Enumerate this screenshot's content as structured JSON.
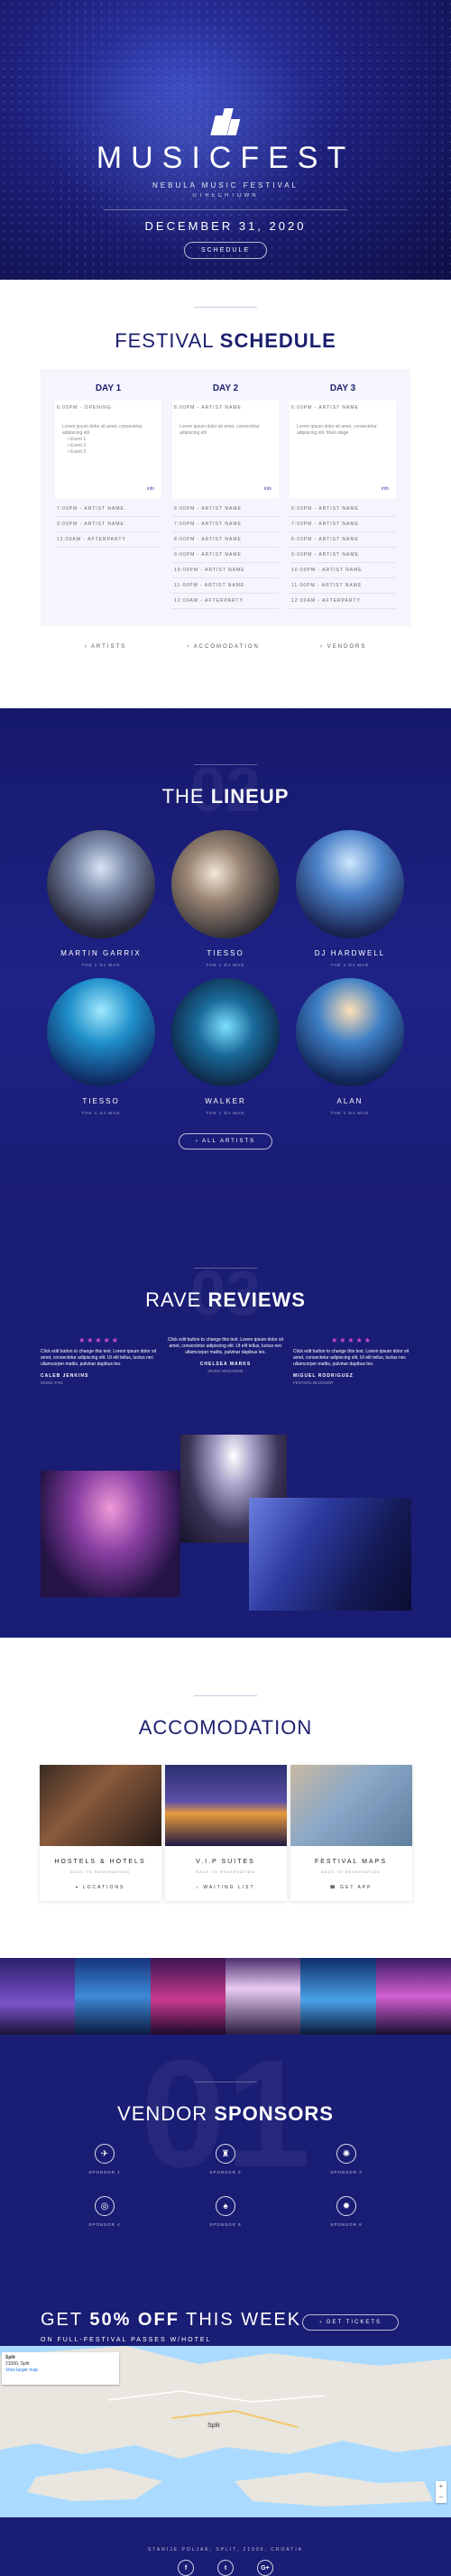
{
  "hero": {
    "title": "MUSICFEST",
    "subtitle": "NEBULA MUSIC FESTIVAL",
    "location": "UTRECHTOWN",
    "date": "DECEMBER 31, 2020",
    "button": "SCHEDULE"
  },
  "schedule": {
    "title_light": "FESTIVAL",
    "title_bold": "SCHEDULE",
    "days": [
      {
        "label": "DAY 1",
        "open_slot": "6:00PM - OPENING",
        "detail": "Lorem ipsum dolor sit amet, consectetur adipiscing elit",
        "bullets": [
          "Event 1",
          "Event 2",
          "Event 3"
        ],
        "more": "info",
        "slots": [
          "7:00PM - ARTIST NAME",
          "9:00PM - ARTIST NAME",
          "12:00AM - AFTERPARTY"
        ]
      },
      {
        "label": "DAY 2",
        "open_slot": "6:00PM - ARTIST NAME",
        "detail": "Lorem ipsum dolor sit amet, consectetur adipiscing elit",
        "bullets": [],
        "more": "info",
        "slots": [
          "6:00PM - ARTIST NAME",
          "7:00PM - ARTIST NAME",
          "8:00PM - ARTIST NAME",
          "9:00PM - ARTIST NAME",
          "10:00PM - ARTIST NAME",
          "11:00PM - ARTIST NAME",
          "12:00AM - AFTERPARTY"
        ]
      },
      {
        "label": "DAY 3",
        "open_slot": "6:00PM - ARTIST NAME",
        "detail": "Lorem ipsum dolor sit amet, consectetur adipiscing elit. Main stage",
        "bullets": [],
        "more": "info",
        "slots": [
          "6:00PM - ARTIST NAME",
          "7:00PM - ARTIST NAME",
          "8:00PM - ARTIST NAME",
          "9:00PM - ARTIST NAME",
          "10:00PM - ARTIST NAME",
          "11:00PM - ARTIST NAME",
          "12:00AM - AFTERPARTY"
        ]
      }
    ],
    "links": [
      "ARTISTS",
      "ACCOMODATION",
      "VENDORS"
    ]
  },
  "lineup": {
    "ghost": "02",
    "title_light": "THE",
    "title_bold": "LINEUP",
    "artists": [
      {
        "name": "MARTIN GARRIX",
        "role": "THE 1 DJ MAG"
      },
      {
        "name": "TIESSO",
        "role": "THE 1 DJ MAG"
      },
      {
        "name": "DJ HARDWELL",
        "role": "THE 1 DJ MAG"
      },
      {
        "name": "TIESSO",
        "role": "THE 1 DJ MAG"
      },
      {
        "name": "WALKER",
        "role": "THE 1 DJ MAG"
      },
      {
        "name": "ALAN",
        "role": "THE 1 DJ MAG"
      }
    ],
    "button": "ALL ARTISTS"
  },
  "reviews": {
    "ghost": "03",
    "title_light": "RAVE",
    "title_bold": "REVIEWS",
    "stars": "★★★★★",
    "items": [
      {
        "text": "Click edit button to change this text. Lorem ipsum dolor sit amet, consectetur adipiscing elit. Ut elit tellus, luctus nec ullamcorper mattis, pulvinar dapibus leo.",
        "name": "CALEB JENKINS",
        "role": "MUSIC FAN"
      },
      {
        "text": "Click edit button to change this text. Lorem ipsum dolor sit amet, consectetur adipiscing elit. Ut elit tellus, luctus nec ullamcorper mattis, pulvinar dapibus leo.",
        "name": "CHELSEA MARKS",
        "role": "MUSIC MAGAZINE"
      },
      {
        "text": "Click edit button to change this text. Lorem ipsum dolor sit amet, consectetur adipiscing elit. Ut elit tellus, luctus nec ullamcorper mattis, pulvinar dapibus leo.",
        "name": "MIGUEL RODRIGUEZ",
        "role": "FESTIVAL BLOGGER"
      }
    ]
  },
  "accom": {
    "title": "ACCOMODATION",
    "cards": [
      {
        "title": "HOSTELS & HOTELS",
        "sub": "BACK TO RESERVATION",
        "link": "LOCATIONS",
        "icon": "pin"
      },
      {
        "title": "V.I.P SUITES",
        "sub": "BACK TO RESERVATION",
        "link": "WAITING LIST",
        "icon": "bell"
      },
      {
        "title": "FESTIVAL MAPS",
        "sub": "BACK TO RESERVATION",
        "link": "GET APP",
        "icon": "phone"
      }
    ]
  },
  "vendors": {
    "ghost": "01",
    "title_light": "VENDOR",
    "title_bold": "SPONSORS",
    "items": [
      {
        "name": "SPONSOR 1",
        "icon": "✈"
      },
      {
        "name": "SPONSOR 2",
        "icon": "♜"
      },
      {
        "name": "SPONSOR 3",
        "icon": "✺"
      },
      {
        "name": "SPONSOR 4",
        "icon": "◎"
      },
      {
        "name": "SPONSOR 5",
        "icon": "♠"
      },
      {
        "name": "SPONSOR 6",
        "icon": "✹"
      }
    ]
  },
  "offer": {
    "prefix": "GET",
    "bold": "50% OFF",
    "suffix": "THIS WEEK",
    "sub": "ON FULL-FESTIVAL PASSES W/HOTEL",
    "button": "GET TICKETS"
  },
  "map": {
    "place": "Split",
    "desc": "21000, Split",
    "link": "View larger map",
    "city_label": "Split",
    "zoom_in": "+",
    "zoom_out": "−"
  },
  "footer": {
    "address": "STARIJE POLJAK, SPLIT, 21000, CROATIA",
    "socials": [
      "f",
      "t",
      "G+"
    ]
  }
}
